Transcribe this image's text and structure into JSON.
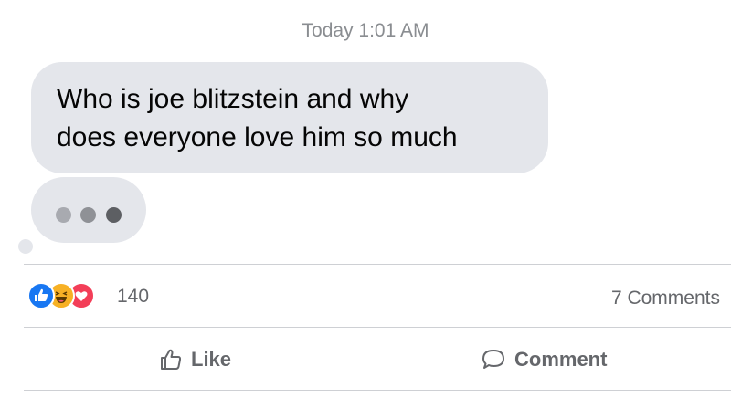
{
  "thread": {
    "timestamp": "Today 1:01 AM",
    "message_line1": "Who is joe blitzstein and why",
    "message_line2": "does everyone love him so much",
    "typing_indicator": "typing-dots"
  },
  "reactions": {
    "icons": [
      "like-icon",
      "haha-icon",
      "love-icon"
    ],
    "count": "140",
    "comments": "7 Comments"
  },
  "actions": {
    "like_label": "Like",
    "comment_label": "Comment"
  },
  "colors": {
    "bubble": "#e4e6eb",
    "like": "#1877f2",
    "haha": "#f7b125",
    "love": "#f33e58",
    "secondary_text": "#65676b"
  }
}
